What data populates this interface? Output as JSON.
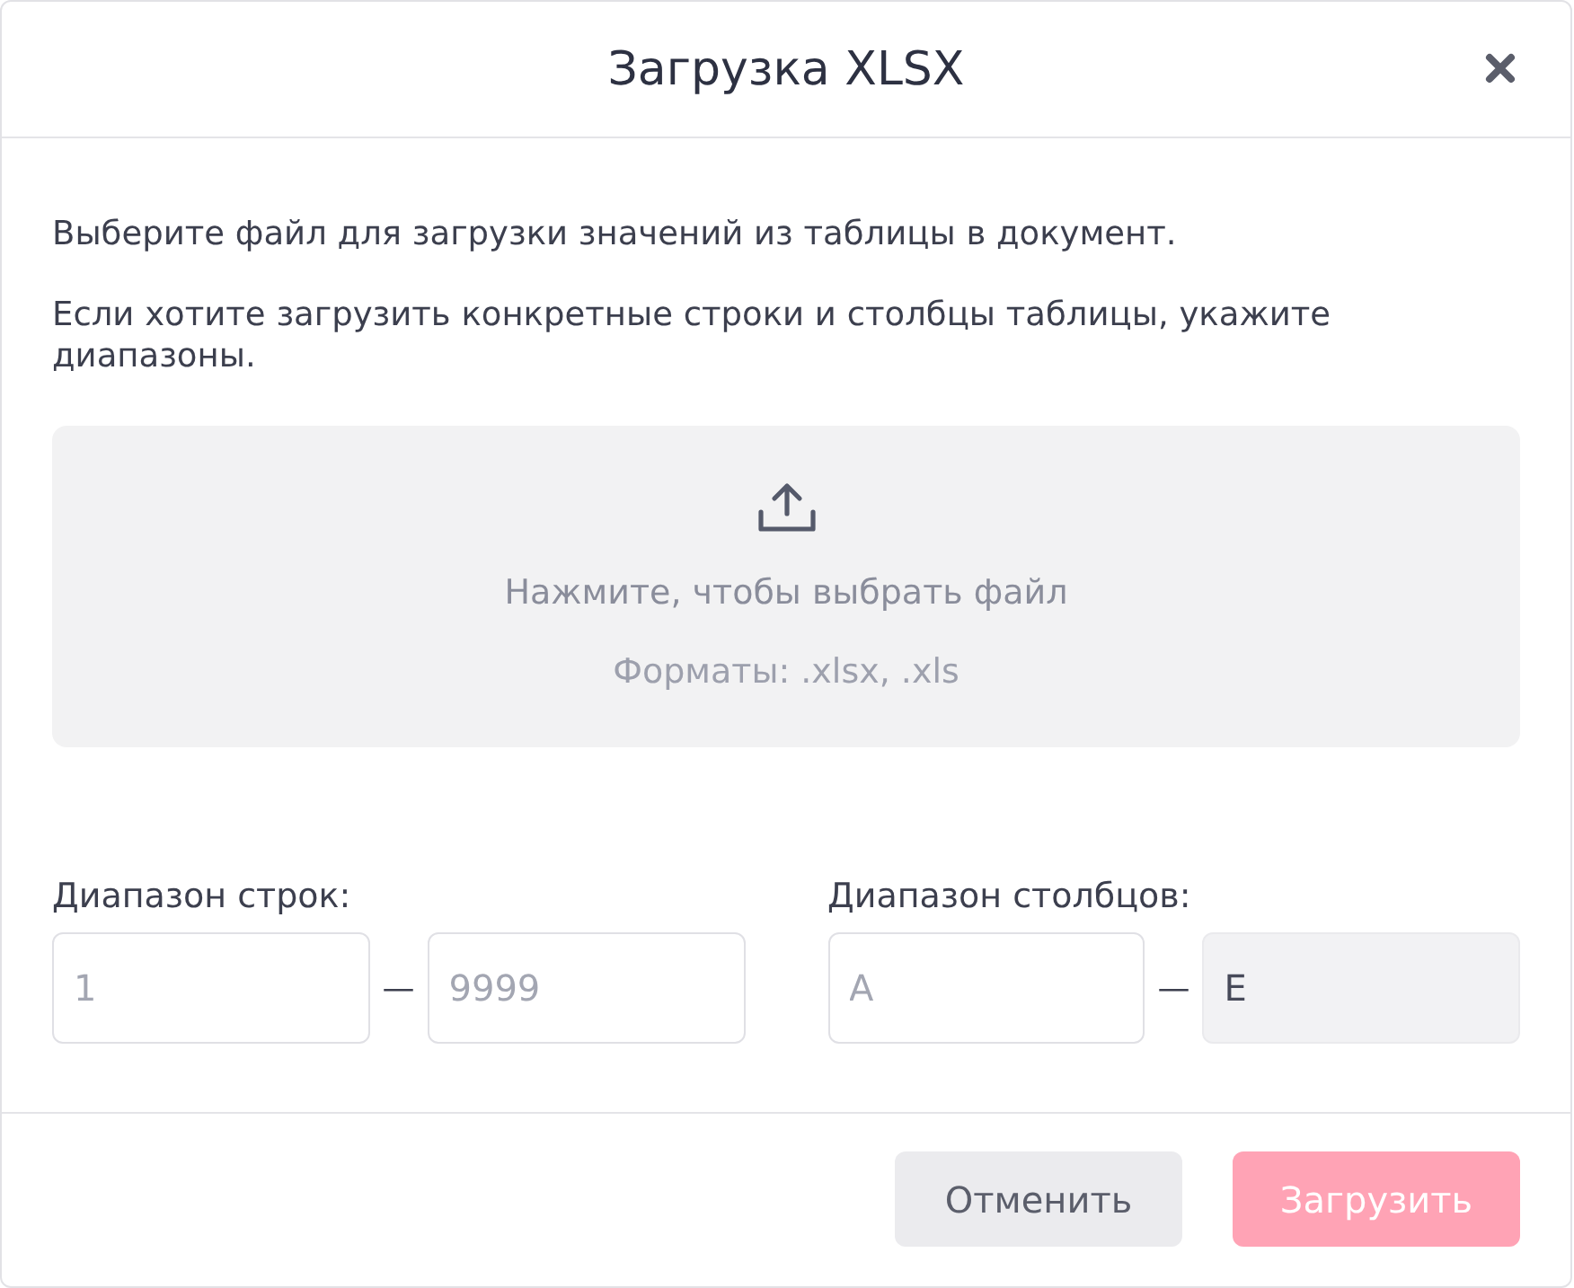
{
  "dialog": {
    "title": "Загрузка XLSX"
  },
  "paragraphs": [
    "Выберите файл для загрузки значений из таблицы в документ.",
    "Если хотите загрузить конкретные строки и столбцы таблицы, укажите диапазоны."
  ],
  "dropzone": {
    "prompt": "Нажмите, чтобы выбрать файл",
    "formats": "Форматы: .xlsx, .xls"
  },
  "ranges": [
    {
      "label": "Диапазон строк:",
      "separator": "—",
      "fields": [
        {
          "placeholder": "1",
          "disabled": false
        },
        {
          "placeholder": "9999",
          "disabled": false
        }
      ]
    },
    {
      "label": "Диапазон столбцов:",
      "separator": "—",
      "fields": [
        {
          "placeholder": "A",
          "disabled": false
        },
        {
          "value": "E",
          "disabled": true
        }
      ]
    }
  ],
  "buttons": [
    {
      "label": "Отменить",
      "kind": "secondary",
      "disabled": false
    },
    {
      "label": "Загрузить",
      "kind": "primary",
      "disabled": true
    }
  ]
}
